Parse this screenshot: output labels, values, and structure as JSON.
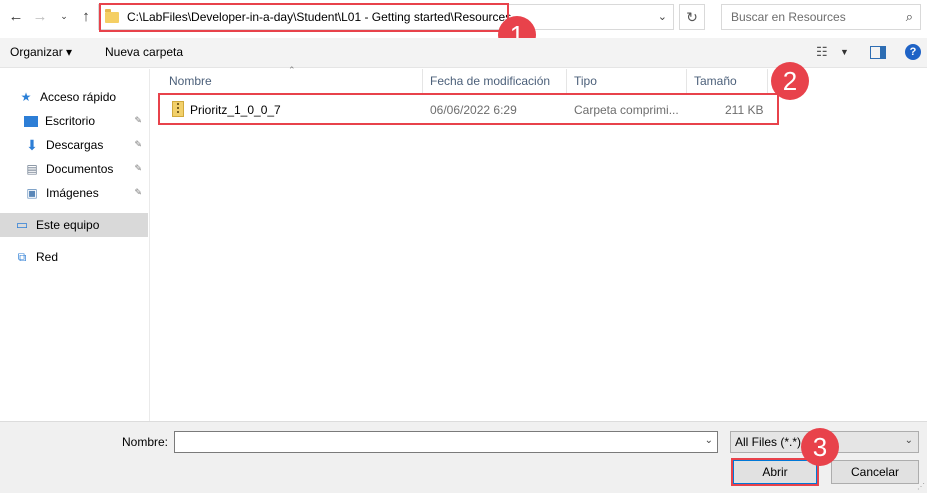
{
  "nav": {
    "back_icon": "arrow-left",
    "forward_icon": "arrow-right",
    "recent_icon": "chevron-down",
    "up_icon": "arrow-up",
    "address": "C:\\LabFiles\\Developer-in-a-day\\Student\\L01 - Getting started\\Resources",
    "search_placeholder": "Buscar en Resources"
  },
  "toolbar": {
    "organize_label": "Organizar ▾",
    "new_folder_label": "Nueva carpeta",
    "help_label": "?"
  },
  "sidebar": {
    "items": [
      {
        "label": "Acceso rápido",
        "icon": "star-icon",
        "pinned": false
      },
      {
        "label": "Escritorio",
        "icon": "desktop-icon",
        "pinned": true
      },
      {
        "label": "Descargas",
        "icon": "download-icon",
        "pinned": true
      },
      {
        "label": "Documentos",
        "icon": "document-icon",
        "pinned": true
      },
      {
        "label": "Imágenes",
        "icon": "image-icon",
        "pinned": true
      },
      {
        "label": "Este equipo",
        "icon": "computer-icon",
        "pinned": false,
        "selected": true
      },
      {
        "label": "Red",
        "icon": "network-icon",
        "pinned": false
      }
    ]
  },
  "file_list": {
    "columns": [
      "Nombre",
      "Fecha de modificación",
      "Tipo",
      "Tamaño"
    ],
    "rows": [
      {
        "name": "Prioritz_1_0_0_7",
        "date": "06/06/2022 6:29",
        "type": "Carpeta comprimi...",
        "size": "211 KB"
      }
    ]
  },
  "bottom": {
    "name_label": "Nombre:",
    "name_value": "",
    "filter_value": "All Files (*.*)",
    "open_label": "Abrir",
    "cancel_label": "Cancelar"
  },
  "annotations": {
    "badges": [
      "1",
      "2",
      "3"
    ],
    "color": "#e8424b"
  },
  "colors": {
    "accent": "#0078d7",
    "selection": "#d9d9d9",
    "column_header_text": "#4c607a"
  }
}
